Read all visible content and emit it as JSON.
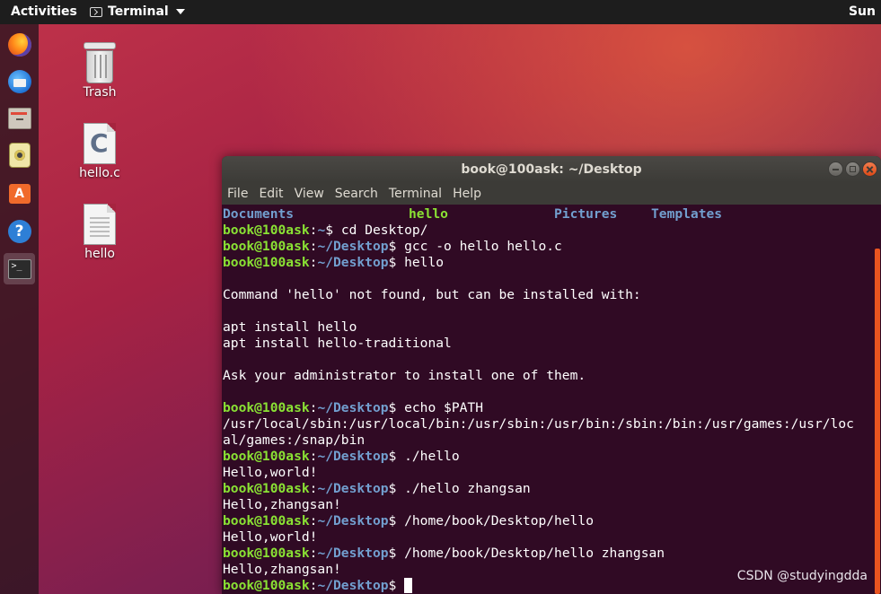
{
  "topbar": {
    "activities": "Activities",
    "app_name": "Terminal",
    "clock": "Sun"
  },
  "dock": {
    "items": [
      {
        "name": "Firefox",
        "icon": "firefox-icon"
      },
      {
        "name": "Thunderbird",
        "icon": "thunderbird-icon"
      },
      {
        "name": "Files",
        "icon": "files-icon"
      },
      {
        "name": "Rhythmbox",
        "icon": "rhythmbox-icon"
      },
      {
        "name": "Ubuntu Software",
        "icon": "software-store-icon",
        "glyph": "A"
      },
      {
        "name": "Help",
        "icon": "help-icon",
        "glyph": "?"
      },
      {
        "name": "Terminal",
        "icon": "terminal-icon",
        "glyph": ">_"
      }
    ]
  },
  "desktop": {
    "icons": [
      {
        "label": "Trash",
        "icon": "trash-icon"
      },
      {
        "label": "hello.c",
        "icon": "c-source-file-icon",
        "glyph": "C"
      },
      {
        "label": "hello",
        "icon": "text-file-icon"
      }
    ]
  },
  "terminal": {
    "title": "book@100ask: ~/Desktop",
    "menu": [
      "File",
      "Edit",
      "View",
      "Search",
      "Terminal",
      "Help"
    ],
    "user": "book@100ask",
    "lines": [
      {
        "type": "ls",
        "cells": [
          "Documents",
          "hello",
          "Pictures",
          "Templates"
        ]
      },
      {
        "type": "prompt",
        "path": "~",
        "cmd": " cd Desktop/"
      },
      {
        "type": "prompt",
        "path": "~/Desktop",
        "cmd": " gcc -o hello hello.c"
      },
      {
        "type": "prompt",
        "path": "~/Desktop",
        "cmd": " hello"
      },
      {
        "type": "out",
        "text": ""
      },
      {
        "type": "out",
        "text": "Command 'hello' not found, but can be installed with:"
      },
      {
        "type": "out",
        "text": ""
      },
      {
        "type": "out",
        "text": "apt install hello"
      },
      {
        "type": "out",
        "text": "apt install hello-traditional"
      },
      {
        "type": "out",
        "text": ""
      },
      {
        "type": "out",
        "text": "Ask your administrator to install one of them."
      },
      {
        "type": "out",
        "text": ""
      },
      {
        "type": "prompt",
        "path": "~/Desktop",
        "cmd": " echo $PATH"
      },
      {
        "type": "out",
        "text": "/usr/local/sbin:/usr/local/bin:/usr/sbin:/usr/bin:/sbin:/bin:/usr/games:/usr/loc"
      },
      {
        "type": "out",
        "text": "al/games:/snap/bin"
      },
      {
        "type": "prompt",
        "path": "~/Desktop",
        "cmd": " ./hello"
      },
      {
        "type": "out",
        "text": "Hello,world!"
      },
      {
        "type": "prompt",
        "path": "~/Desktop",
        "cmd": " ./hello zhangsan"
      },
      {
        "type": "out",
        "text": "Hello,zhangsan!"
      },
      {
        "type": "prompt",
        "path": "~/Desktop",
        "cmd": " /home/book/Desktop/hello"
      },
      {
        "type": "out",
        "text": "Hello,world!"
      },
      {
        "type": "prompt",
        "path": "~/Desktop",
        "cmd": " /home/book/Desktop/hello zhangsan"
      },
      {
        "type": "out",
        "text": "Hello,zhangsan!"
      },
      {
        "type": "prompt",
        "path": "~/Desktop",
        "cmd": " ",
        "cursor": true
      }
    ]
  },
  "watermark": "CSDN @studyingdda",
  "colors": {
    "terminal_bg": "#300a24",
    "prompt_user": "#8ae234",
    "prompt_path": "#729fcf",
    "accent": "#e95420"
  }
}
